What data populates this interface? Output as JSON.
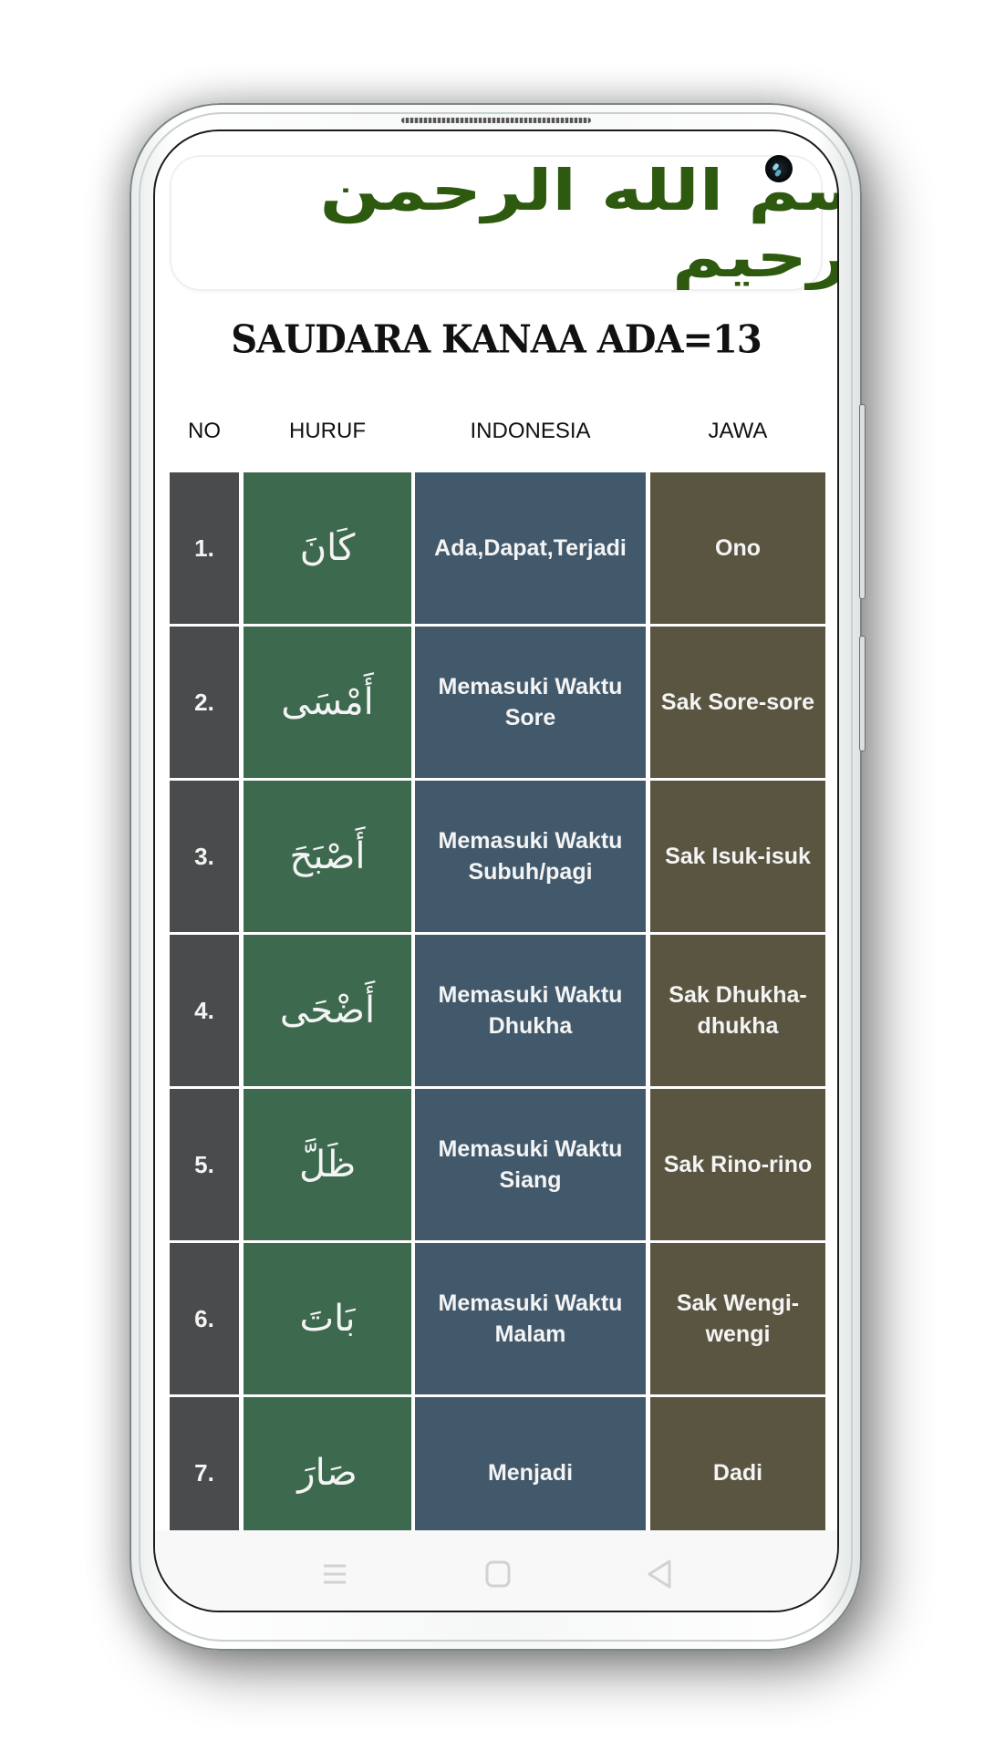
{
  "header": {
    "bismillah": "بسم الله الرحمن الرحيم"
  },
  "title": "SAUDARA KANAA ADA=13",
  "table": {
    "columns": [
      "NO",
      "HURUF",
      "INDONESIA",
      "JAWA"
    ],
    "rows": [
      {
        "no": "1.",
        "huruf": "كَانَ",
        "indonesia": "Ada,Dapat,Terjadi",
        "jawa": "Ono"
      },
      {
        "no": "2.",
        "huruf": "أَمْسَى",
        "indonesia": "Memasuki Waktu Sore",
        "jawa": "Sak Sore-sore"
      },
      {
        "no": "3.",
        "huruf": "أَصْبَحَ",
        "indonesia": "Memasuki Waktu Subuh/pagi",
        "jawa": "Sak Isuk-isuk"
      },
      {
        "no": "4.",
        "huruf": "أَضْحَى",
        "indonesia": "Memasuki Waktu Dhukha",
        "jawa": "Sak Dhukha-dhukha"
      },
      {
        "no": "5.",
        "huruf": "ظَلَّ",
        "indonesia": "Memasuki Waktu Siang",
        "jawa": "Sak Rino-rino"
      },
      {
        "no": "6.",
        "huruf": "بَاتَ",
        "indonesia": "Memasuki Waktu Malam",
        "jawa": "Sak Wengi-wengi"
      },
      {
        "no": "7.",
        "huruf": "صَارَ",
        "indonesia": "Menjadi",
        "jawa": "Dadi"
      }
    ]
  },
  "colors": {
    "no_column": "#4a4b4d",
    "huruf_column": "#3d6a4f",
    "indonesia_column": "#42596b",
    "jawa_column": "#5a5541",
    "bismillah_text": "#2d5a0e"
  },
  "navbar": {
    "icons": [
      "menu-icon",
      "home-icon",
      "back-icon"
    ]
  }
}
